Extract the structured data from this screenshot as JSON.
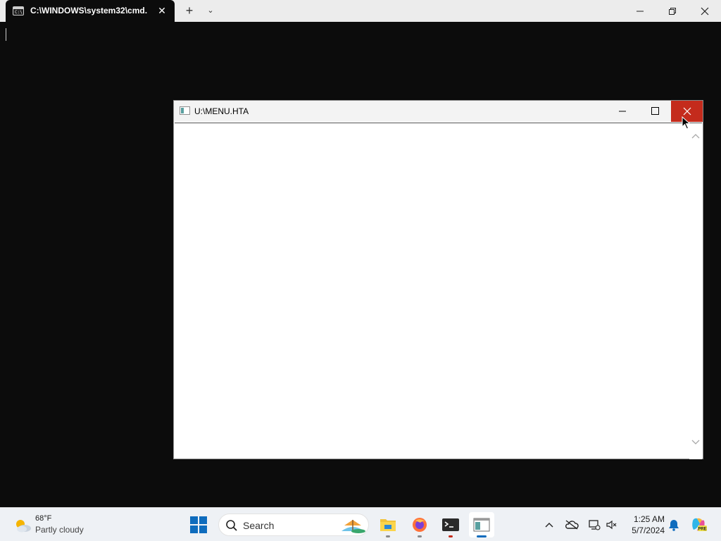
{
  "terminal": {
    "tab_title": "C:\\WINDOWS\\system32\\cmd.",
    "tab_icon_text": "C:\\"
  },
  "hta_window": {
    "title": "U:\\MENU.HTA"
  },
  "taskbar": {
    "weather": {
      "temp": "68°F",
      "desc": "Partly cloudy"
    },
    "search": {
      "placeholder": "Search"
    },
    "clock": {
      "time": "1:25 AM",
      "date": "5/7/2024"
    },
    "copilot_badge": "PRE"
  },
  "colors": {
    "close_hover": "#c42b1c",
    "accent": "#0f6cbd",
    "terminal_bg": "#0c0c0c"
  }
}
